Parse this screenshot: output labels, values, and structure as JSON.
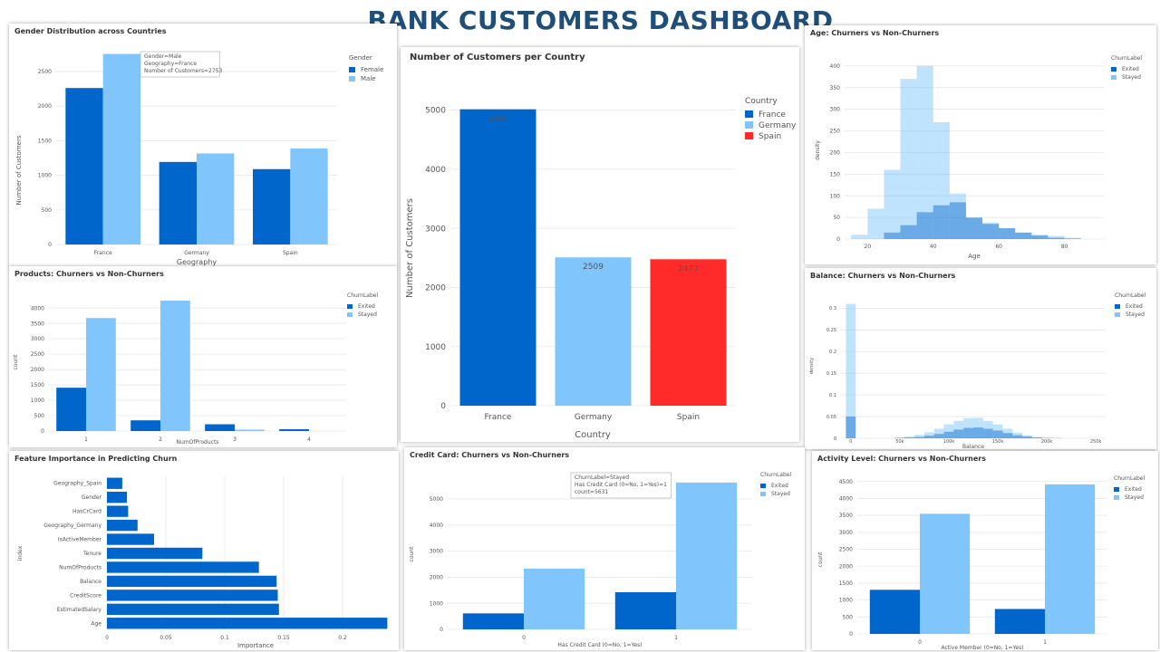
{
  "dashboard_title": "BANK CUSTOMERS DASHBOARD",
  "colors": {
    "exited": "#0066cc",
    "stayed": "#80c5fb",
    "spain": "#ff2a2a",
    "title": "#1f4e79"
  },
  "chart_data": [
    {
      "id": "gender",
      "type": "bar",
      "title": "Gender Distribution across Countries",
      "xlabel": "Geography",
      "ylabel": "Number of Customers",
      "categories": [
        "France",
        "Germany",
        "Spain"
      ],
      "yticks": [
        0,
        500,
        1000,
        1500,
        2000,
        2500
      ],
      "ylim": [
        0,
        2800
      ],
      "legend_title": "Gender",
      "series": [
        {
          "name": "Female",
          "values": [
            2261,
            1193,
            1089
          ]
        },
        {
          "name": "Male",
          "values": [
            2753,
            1316,
            1388
          ]
        }
      ],
      "tooltip": [
        "Gender=Male",
        "Geography=France",
        "Number of Customers=2753"
      ]
    },
    {
      "id": "country",
      "type": "bar",
      "title": "Number of Customers per Country",
      "xlabel": "Country",
      "ylabel": "Number of Customers",
      "categories": [
        "France",
        "Germany",
        "Spain"
      ],
      "values": [
        5014,
        2509,
        2477
      ],
      "data_labels": [
        "5014",
        "2509",
        "2477"
      ],
      "yticks": [
        0,
        1000,
        2000,
        3000,
        4000,
        5000
      ],
      "ylim": [
        0,
        5300
      ],
      "legend_title": "Country",
      "legend": [
        "France",
        "Germany",
        "Spain"
      ]
    },
    {
      "id": "age",
      "type": "histogram",
      "title": "Age: Churners vs Non-Churners",
      "xlabel": "Age",
      "ylabel": "density",
      "legend_title": "ChurnLabel",
      "bins_x": [
        15,
        20,
        25,
        30,
        35,
        40,
        45,
        50,
        55,
        60,
        65,
        70,
        75,
        80,
        85
      ],
      "series": [
        {
          "name": "Exited",
          "values": [
            0,
            0,
            15,
            32,
            62,
            78,
            85,
            50,
            35,
            25,
            15,
            8,
            3,
            1
          ]
        },
        {
          "name": "Stayed",
          "values": [
            10,
            70,
            160,
            370,
            400,
            270,
            105,
            48,
            38,
            25,
            15,
            10,
            7,
            3
          ]
        }
      ],
      "xticks": [
        20,
        40,
        60,
        80
      ],
      "yticks": [
        0,
        50,
        100,
        150,
        200,
        250,
        300,
        350,
        400
      ],
      "xlim": [
        13,
        92
      ],
      "ylim": [
        0,
        410
      ]
    },
    {
      "id": "products",
      "type": "bar",
      "title": "Products: Churners vs Non-Churners",
      "xlabel": "NumOfProducts",
      "ylabel": "count",
      "legend_title": "ChurnLabel",
      "categories": [
        1,
        2,
        3,
        4
      ],
      "series": [
        {
          "name": "Exited",
          "values": [
            1409,
            348,
            220,
            60
          ]
        },
        {
          "name": "Stayed",
          "values": [
            3675,
            4242,
            46,
            0
          ]
        }
      ],
      "xticks": [
        "1",
        "2",
        "3",
        "4"
      ],
      "yticks": [
        0,
        500,
        1000,
        1500,
        2000,
        2500,
        3000,
        3500,
        4000
      ],
      "ylim": [
        0,
        4300
      ]
    },
    {
      "id": "balance",
      "type": "histogram",
      "title": "Balance: Churners vs Non-Churners",
      "xlabel": "Balance",
      "ylabel": "density",
      "legend_title": "ChurnLabel",
      "bin_width": 10000,
      "series": [
        {
          "name": "Exited",
          "values": [
            0.05,
            0,
            0,
            0,
            0,
            0.001,
            0.002,
            0.003,
            0.006,
            0.01,
            0.015,
            0.02,
            0.024,
            0.025,
            0.022,
            0.018,
            0.012,
            0.007,
            0.004,
            0.002,
            0.001,
            0.0005
          ]
        },
        {
          "name": "Stayed",
          "values": [
            0.31,
            0,
            0,
            0,
            0,
            0.002,
            0.004,
            0.008,
            0.014,
            0.022,
            0.032,
            0.04,
            0.046,
            0.047,
            0.04,
            0.032,
            0.022,
            0.013,
            0.007,
            0.003,
            0.001,
            0.0005
          ]
        }
      ],
      "xticks": [
        "0",
        "50k",
        "100k",
        "150k",
        "200k",
        "250k"
      ],
      "xtick_values": [
        0,
        50000,
        100000,
        150000,
        200000,
        250000
      ],
      "yticks": [
        "0",
        "0.05",
        "0.1",
        "0.15",
        "0.2",
        "0.25",
        "0.3"
      ],
      "ytick_values": [
        0,
        0.05,
        0.1,
        0.15,
        0.2,
        0.25,
        0.3
      ],
      "xlim": [
        -10000,
        260000
      ],
      "ylim": [
        0,
        0.33
      ]
    },
    {
      "id": "importance",
      "type": "bar",
      "orientation": "horizontal",
      "title": "Feature Importance in Predicting Churn",
      "xlabel": "Importance",
      "ylabel": "index",
      "categories": [
        "Geography_Spain",
        "Gender",
        "HasCrCard",
        "Geography_Germany",
        "IsActiveMember",
        "Tenure",
        "NumOfProducts",
        "Balance",
        "CreditScore",
        "EstimatedSalary",
        "Age"
      ],
      "values": [
        0.013,
        0.017,
        0.018,
        0.026,
        0.04,
        0.081,
        0.129,
        0.144,
        0.145,
        0.146,
        0.238
      ],
      "xticks": [
        "0",
        "0.05",
        "0.1",
        "0.15",
        "0.2"
      ],
      "xtick_values": [
        0,
        0.05,
        0.1,
        0.15,
        0.2
      ],
      "xlim": [
        0,
        0.24
      ]
    },
    {
      "id": "creditcard",
      "type": "bar",
      "title": "Credit Card: Churners vs Non-Churners",
      "xlabel": "Has Credit Card (0=No, 1=Yes)",
      "ylabel": "count",
      "legend_title": "ChurnLabel",
      "categories": [
        "0",
        "1"
      ],
      "series": [
        {
          "name": "Exited",
          "values": [
            613,
            1424
          ]
        },
        {
          "name": "Stayed",
          "values": [
            2332,
            5631
          ]
        }
      ],
      "yticks": [
        0,
        1000,
        2000,
        3000,
        4000,
        5000
      ],
      "ylim": [
        0,
        5800
      ],
      "tooltip": [
        "ChurnLabel=Stayed",
        "Has Credit Card (0=No, 1=Yes)=1",
        "count=5631"
      ]
    },
    {
      "id": "activity",
      "type": "bar",
      "title": "Activity Level: Churners vs Non-Churners",
      "xlabel": "Active Member (0=No, 1=Yes)",
      "ylabel": "count",
      "legend_title": "ChurnLabel",
      "categories": [
        "0",
        "1"
      ],
      "series": [
        {
          "name": "Exited",
          "values": [
            1302,
            735
          ]
        },
        {
          "name": "Stayed",
          "values": [
            3547,
            4416
          ]
        }
      ],
      "yticks": [
        0,
        500,
        1000,
        1500,
        2000,
        2500,
        3000,
        3500,
        4000,
        4500
      ],
      "ylim": [
        0,
        4600
      ]
    }
  ]
}
